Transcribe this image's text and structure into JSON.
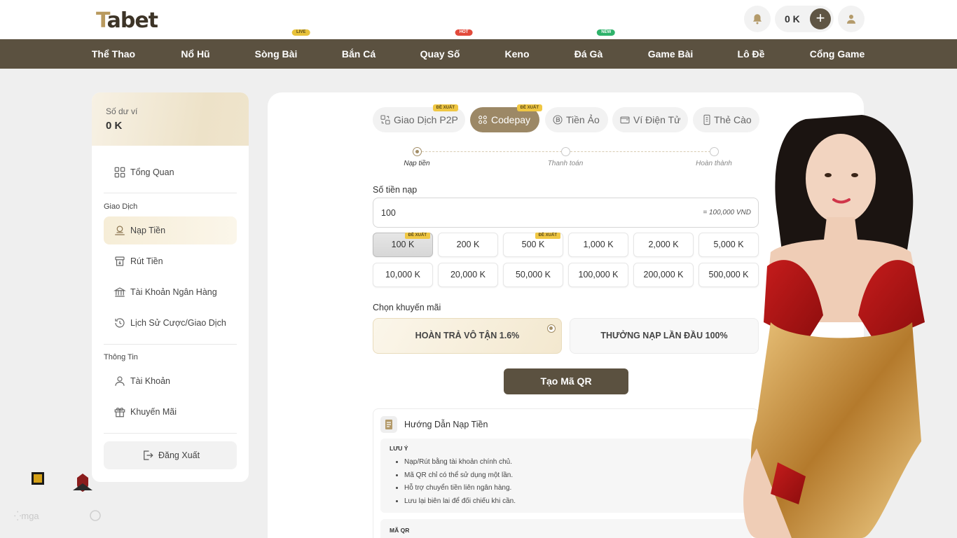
{
  "brand": {
    "logo_text_accent": "T",
    "logo_text_rest": "abet"
  },
  "header": {
    "wallet_amount": "0 K"
  },
  "nav": {
    "items": [
      {
        "label": "Thể Thao",
        "badge": ""
      },
      {
        "label": "Nổ Hũ",
        "badge": ""
      },
      {
        "label": "Sòng Bài",
        "badge": "LIVE"
      },
      {
        "label": "Bắn Cá",
        "badge": ""
      },
      {
        "label": "Quay Số",
        "badge": "HOT"
      },
      {
        "label": "Keno",
        "badge": ""
      },
      {
        "label": "Đá Gà",
        "badge": "NEW"
      },
      {
        "label": "Game Bài",
        "badge": ""
      },
      {
        "label": "Lô Đề",
        "badge": ""
      },
      {
        "label": "Cổng Game",
        "badge": ""
      }
    ]
  },
  "sidebar": {
    "balance_label": "Số dư ví",
    "balance_value": "0 K",
    "overview": "Tổng Quan",
    "section_transactions": "Giao Dịch",
    "deposit": "Nạp Tiền",
    "withdraw": "Rút Tiền",
    "bank_account": "Tài Khoản Ngân Hàng",
    "history": "Lịch Sử Cược/Giao Dịch",
    "section_info": "Thông Tin",
    "account": "Tài Khoản",
    "promotions": "Khuyến Mãi",
    "logout": "Đăng Xuất"
  },
  "tabs": [
    {
      "label": "Giao Dịch P2P",
      "badge": "ĐỀ XUẤT"
    },
    {
      "label": "Codepay",
      "badge": "ĐỀ XUẤT"
    },
    {
      "label": "Tiền Ảo",
      "badge": ""
    },
    {
      "label": "Ví Điện Tử",
      "badge": ""
    },
    {
      "label": "Thẻ Cào",
      "badge": ""
    }
  ],
  "steps": [
    "Nạp tiền",
    "Thanh toán",
    "Hoàn thành"
  ],
  "deposit": {
    "amount_label": "Số tiền nạp",
    "amount_value": "100",
    "amount_conversion": "= 100,000 VND",
    "chips": [
      {
        "label": "100 K",
        "badge": "ĐỀ XUẤT"
      },
      {
        "label": "200 K",
        "badge": ""
      },
      {
        "label": "500 K",
        "badge": "ĐỀ XUẤT"
      },
      {
        "label": "1,000 K",
        "badge": ""
      },
      {
        "label": "2,000 K",
        "badge": ""
      },
      {
        "label": "5,000 K",
        "badge": ""
      },
      {
        "label": "10,000 K",
        "badge": ""
      },
      {
        "label": "20,000 K",
        "badge": ""
      },
      {
        "label": "50,000 K",
        "badge": ""
      },
      {
        "label": "100,000 K",
        "badge": ""
      },
      {
        "label": "200,000 K",
        "badge": ""
      },
      {
        "label": "500,000 K",
        "badge": ""
      }
    ],
    "promo_label": "Chọn khuyến mãi",
    "promos": [
      "HOÀN TRẢ VÔ TẬN 1.6%",
      "THƯỞNG NẠP LẦN ĐẦU 100%"
    ],
    "create_qr": "Tạo Mã QR"
  },
  "guide": {
    "title": "Hướng Dẫn Nạp Tiền",
    "note_title": "LƯU Ý",
    "notes": [
      "Nạp/Rút bằng tài khoản chính chủ.",
      "Mã QR chỉ có thể sử dụng một lần.",
      "Hỗ trợ chuyển tiền liên ngân hàng.",
      "Lưu lại biên lai để đối chiếu khi cần."
    ],
    "qr_title": "MÃ QR"
  },
  "colors": {
    "brand_dark": "#5b5140",
    "accent_gold": "#a28d66",
    "badge_yellow": "#f0c743",
    "live_badge": "#e8c23a",
    "hot_badge": "#e24a3b",
    "new_badge": "#2fb36b"
  }
}
